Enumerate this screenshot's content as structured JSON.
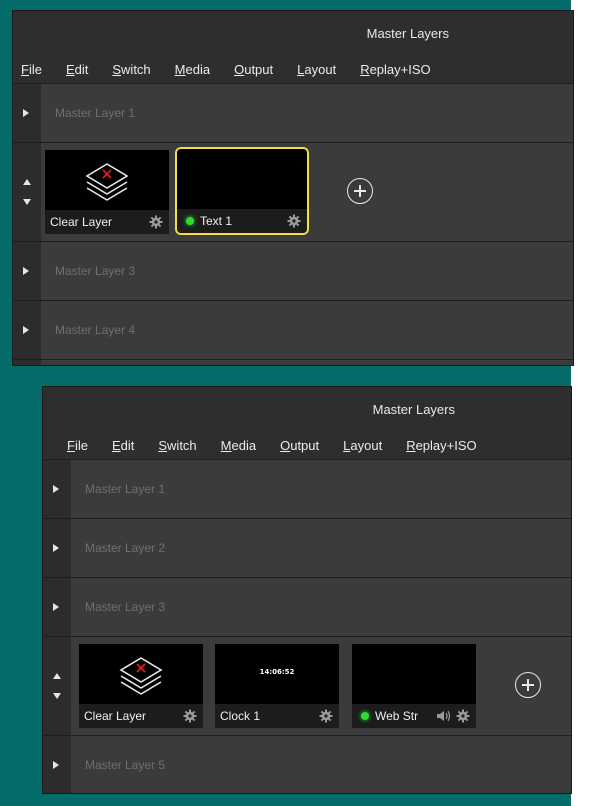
{
  "panels": [
    {
      "title": "Master Layers",
      "menu": [
        {
          "acc": "F",
          "rest": "ile"
        },
        {
          "acc": "E",
          "rest": "dit"
        },
        {
          "acc": "S",
          "rest": "witch"
        },
        {
          "acc": "M",
          "rest": "edia"
        },
        {
          "acc": "O",
          "rest": "utput"
        },
        {
          "acc": "L",
          "rest": "ayout"
        },
        {
          "acc": "R",
          "rest": "eplay+ISO"
        }
      ],
      "layers": [
        {
          "name": "Master Layer 1",
          "expanded": false
        },
        {
          "name": "",
          "expanded": true,
          "inputs": [
            {
              "label": "Clear Layer",
              "type": "clear"
            },
            {
              "label": "Text 1",
              "type": "text",
              "selected": true,
              "live": true
            }
          ]
        },
        {
          "name": "Master Layer 3",
          "expanded": false
        },
        {
          "name": "Master Layer 4",
          "expanded": false
        }
      ]
    },
    {
      "title": "Master Layers",
      "menu": [
        {
          "acc": "F",
          "rest": "ile"
        },
        {
          "acc": "E",
          "rest": "dit"
        },
        {
          "acc": "S",
          "rest": "witch"
        },
        {
          "acc": "M",
          "rest": "edia"
        },
        {
          "acc": "O",
          "rest": "utput"
        },
        {
          "acc": "L",
          "rest": "ayout"
        },
        {
          "acc": "R",
          "rest": "eplay+ISO"
        }
      ],
      "layers": [
        {
          "name": "Master Layer 1",
          "expanded": false
        },
        {
          "name": "Master Layer 2",
          "expanded": false
        },
        {
          "name": "Master Layer 3",
          "expanded": false
        },
        {
          "name": "",
          "expanded": true,
          "inputs": [
            {
              "label": "Clear Layer",
              "type": "clear"
            },
            {
              "label": "Clock 1",
              "type": "clock",
              "clock_text": "14:06:52"
            },
            {
              "label": "Web Str",
              "type": "web",
              "live": true,
              "audio": true
            }
          ]
        },
        {
          "name": "Master Layer 5",
          "expanded": false
        }
      ]
    }
  ],
  "colors": {
    "selected_border": "#f3e040",
    "live_dot": "#2fdc2f",
    "teal_background": "#046b6b"
  }
}
